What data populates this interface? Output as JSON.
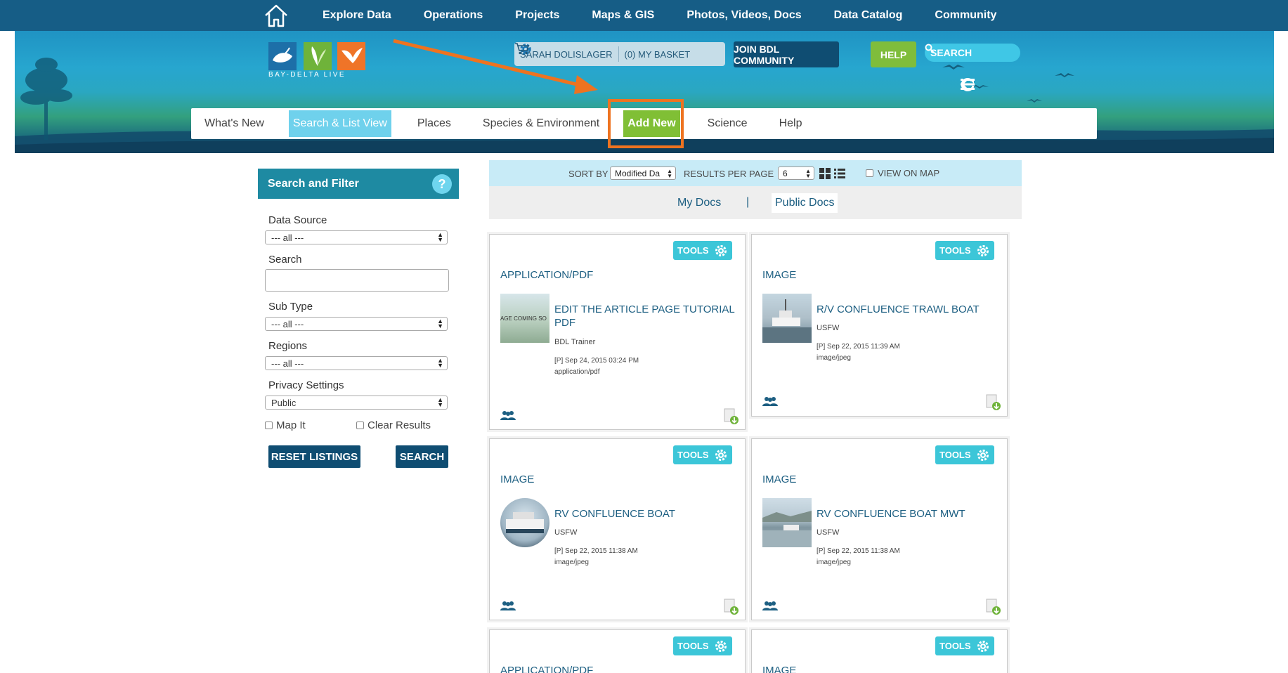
{
  "topnav": {
    "items": [
      "Explore Data",
      "Operations",
      "Projects",
      "Maps & GIS",
      "Photos, Videos, Docs",
      "Data Catalog",
      "Community"
    ]
  },
  "header": {
    "logo_text": "BAY-DELTA LIVE",
    "user_name": "SARAH DOLISLAGER",
    "basket_label": "(0) MY BASKET",
    "join_label": "JOIN BDL COMMUNITY",
    "help_label": "HELP",
    "search_label": "SEARCH"
  },
  "secnav": {
    "items": [
      "What's New",
      "Search & List View",
      "Places",
      "Species & Environment",
      "Add New",
      "Science",
      "Help"
    ]
  },
  "filter": {
    "title": "Search and Filter",
    "help_icon": "?",
    "data_source_label": "Data Source",
    "data_source_value": "--- all ---",
    "search_label": "Search",
    "search_value": "",
    "sub_type_label": "Sub Type",
    "sub_type_value": "--- all ---",
    "regions_label": "Regions",
    "regions_value": "--- all ---",
    "privacy_label": "Privacy Settings",
    "privacy_value": "Public",
    "map_it_label": "Map It",
    "clear_results_label": "Clear Results",
    "reset_label": "RESET LISTINGS",
    "search_button_label": "SEARCH"
  },
  "results": {
    "sort_by_label": "SORT BY",
    "sort_value": "Modified Da",
    "per_page_label": "RESULTS PER PAGE",
    "per_page_value": "6",
    "view_on_map_label": "VIEW ON MAP",
    "my_docs_label": "My Docs",
    "separator": "|",
    "public_docs_label": "Public Docs",
    "tools_label": "TOOLS",
    "cards": [
      {
        "type": "APPLICATION/PDF",
        "title": "EDIT THE ARTICLE PAGE TUTORIAL PDF",
        "author": "BDL Trainer",
        "date": "[P] Sep 24, 2015 03:24 PM",
        "mime": "application/pdf",
        "thumb_text": "AGE COMING SO"
      },
      {
        "type": "IMAGE",
        "title": "R/V CONFLUENCE TRAWL BOAT",
        "author": "USFW",
        "date": "[P] Sep 22, 2015 11:39 AM",
        "mime": "image/jpeg"
      },
      {
        "type": "IMAGE",
        "title": "RV CONFLUENCE BOAT",
        "author": "USFW",
        "date": "[P] Sep 22, 2015 11:38 AM",
        "mime": "image/jpeg"
      },
      {
        "type": "IMAGE",
        "title": "RV CONFLUENCE BOAT MWT",
        "author": "USFW",
        "date": "[P] Sep 22, 2015 11:38 AM",
        "mime": "image/jpeg"
      },
      {
        "type": "APPLICATION/PDF"
      },
      {
        "type": "IMAGE"
      }
    ]
  },
  "colors": {
    "nav_blue": "#165d86",
    "accent_green": "#80bf35",
    "accent_cyan": "#3cc6d8",
    "highlight_orange": "#ee7320"
  },
  "icons": [
    "home-icon",
    "gear-icon",
    "cart-icon",
    "search-icon",
    "back-arrow-icon",
    "refresh-icon",
    "list-icon",
    "help-icon",
    "grid-view-icon",
    "list-view-icon",
    "users-icon",
    "download-icon"
  ]
}
